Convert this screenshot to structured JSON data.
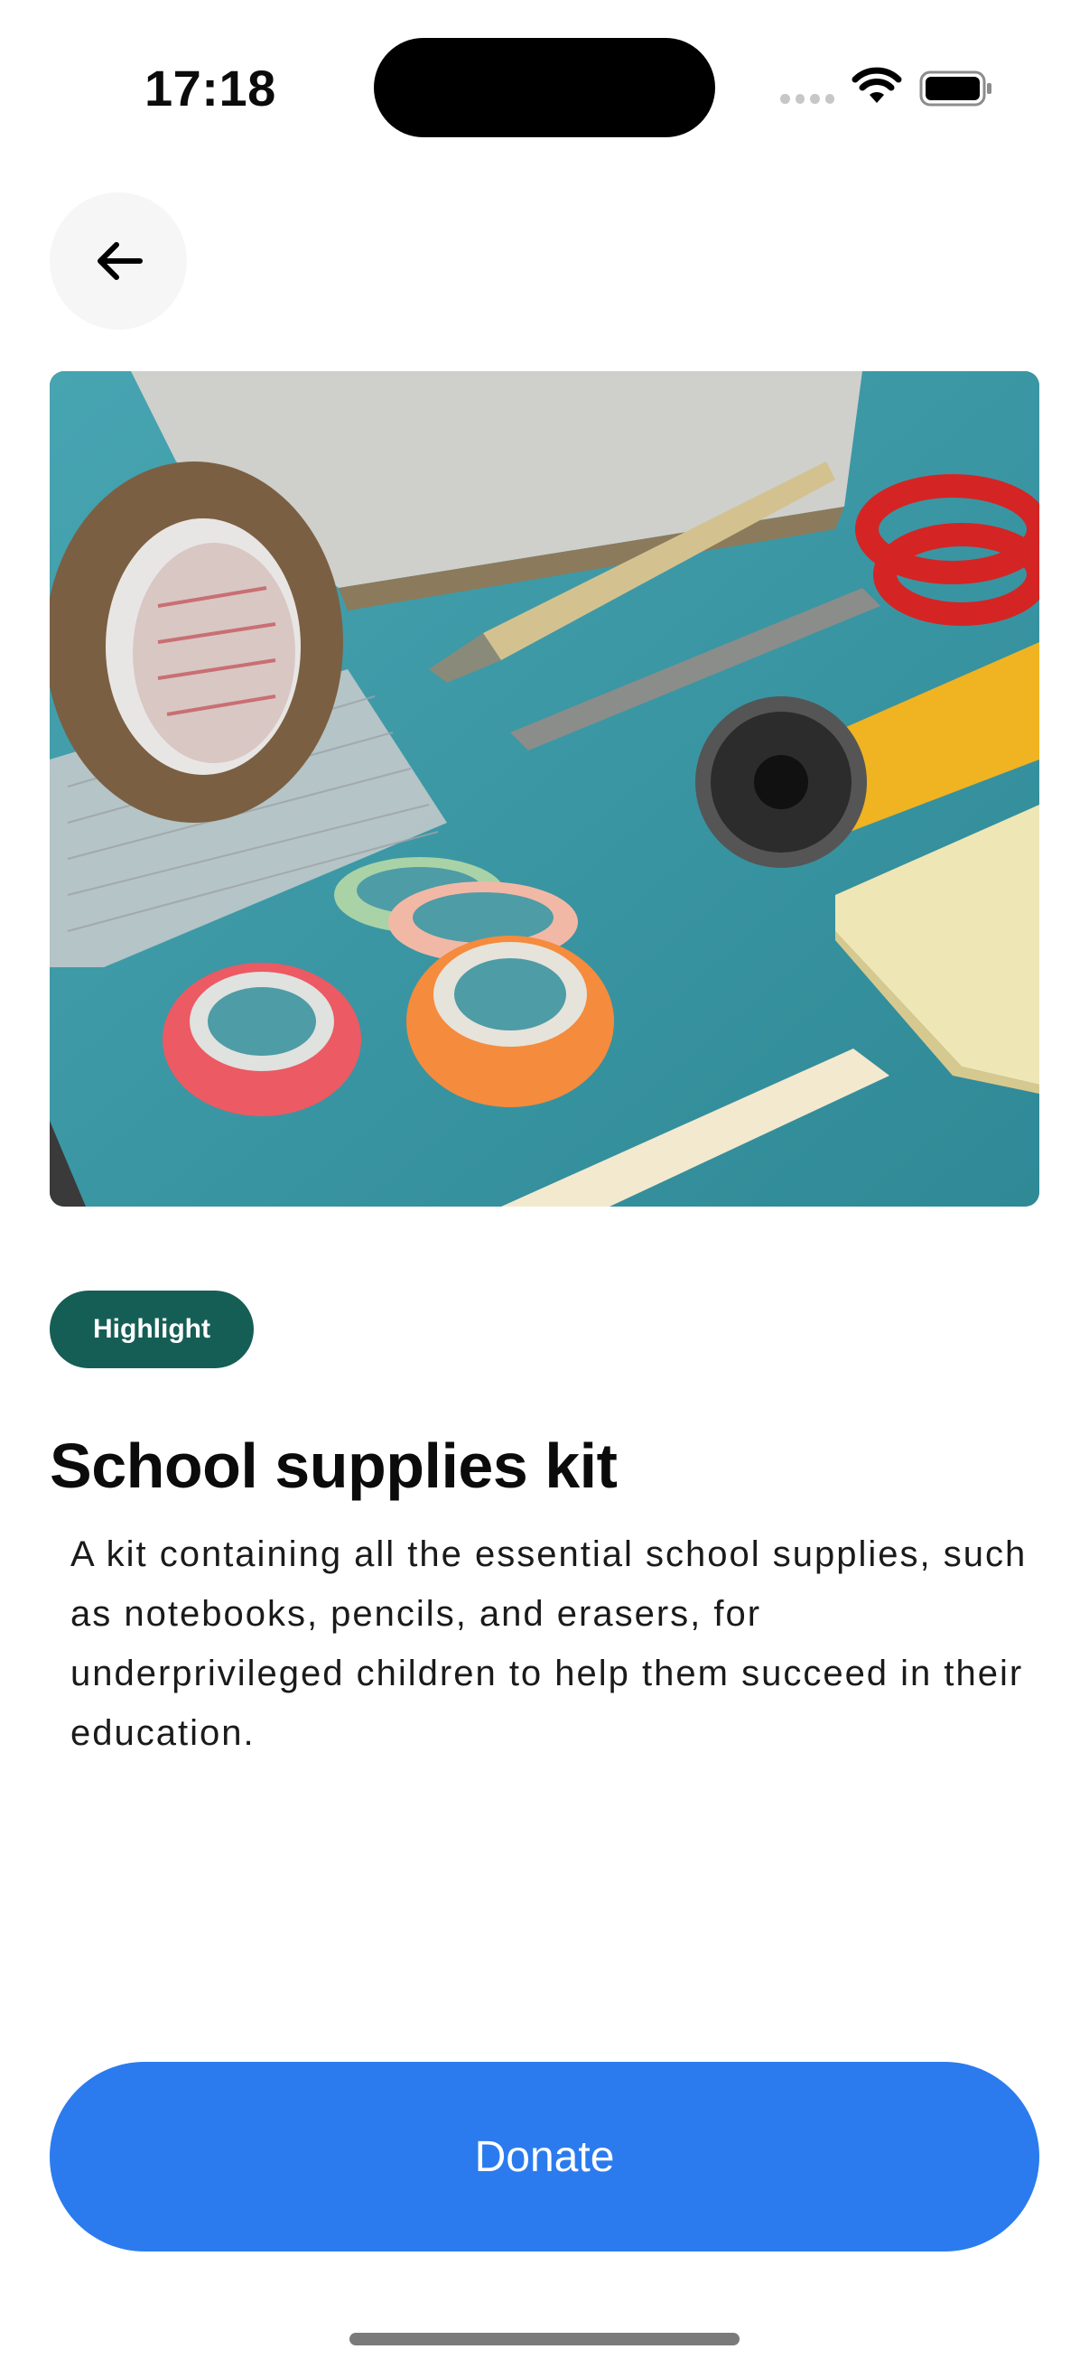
{
  "status_bar": {
    "time": "17:18"
  },
  "icons": {
    "back": "arrow-left-icon",
    "wifi": "wifi-icon",
    "battery": "battery-icon",
    "signal": "cellular-signal-icon"
  },
  "product": {
    "image_description": "school-supplies-photo",
    "badge": "Highlight",
    "title": "School supplies kit",
    "description": "A kit containing all the essential school supplies, such as notebooks, pencils, and erasers, for underprivileged children to help them succeed in their education."
  },
  "actions": {
    "donate_label": "Donate"
  },
  "colors": {
    "badge_bg": "#155e55",
    "primary_button": "#2b7bef",
    "back_button_bg": "#f6f6f6"
  }
}
